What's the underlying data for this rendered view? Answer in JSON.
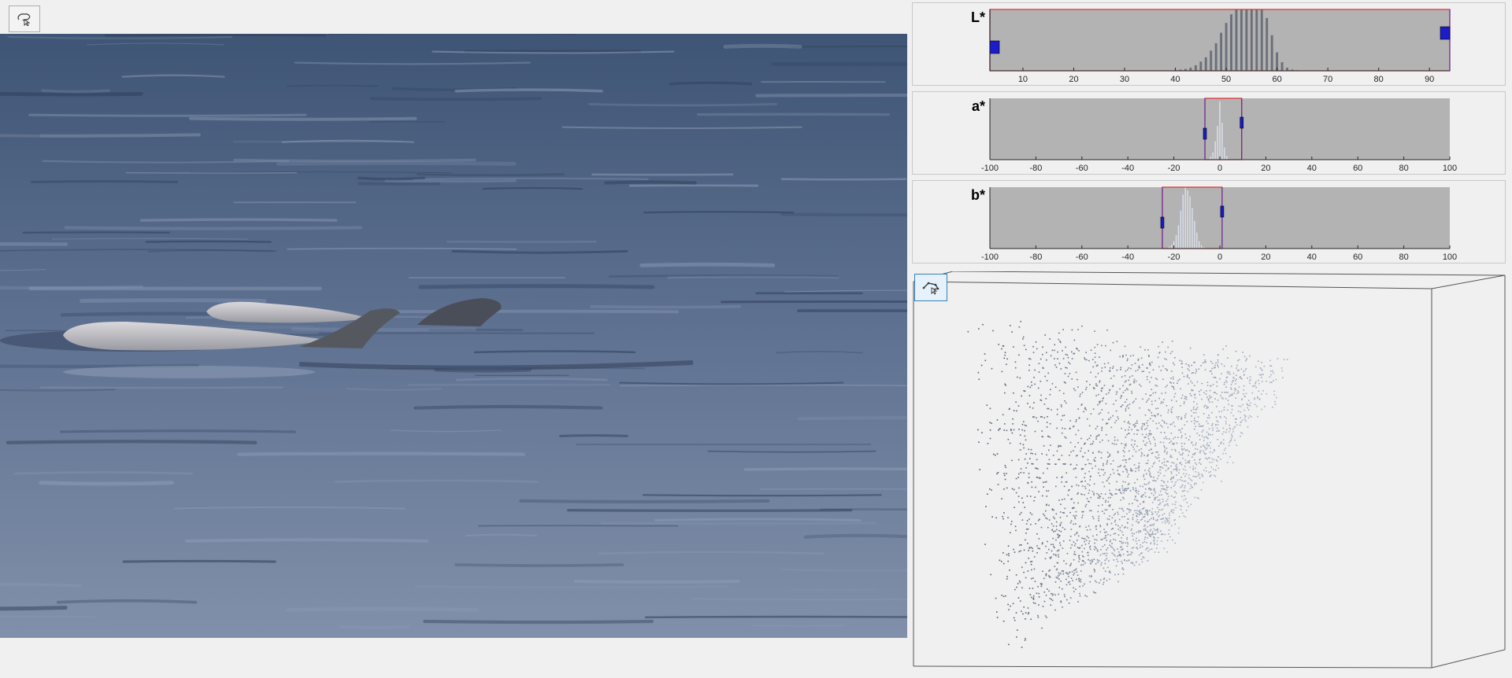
{
  "toolbar": {
    "freehand_tool": {
      "icon": "freehand-lasso-icon"
    },
    "polygon_tool": {
      "icon": "polygon-lasso-icon",
      "active": true
    }
  },
  "colors": {
    "histogram_background": "#b3b3b3",
    "range_box": "#e02828",
    "handle": "#1c1cc8",
    "polygon_tool_active": "#e5f1fb",
    "water_top": "#3f5575",
    "water_bottom": "#8190aa"
  },
  "histograms": [
    {
      "channel": "L*",
      "ticks": [
        "10",
        "20",
        "30",
        "40",
        "50",
        "60",
        "70",
        "80",
        "90"
      ],
      "axis_min": 3.5,
      "axis_max": 94,
      "selected_range": [
        3.5,
        94
      ],
      "bins": [
        [
          40,
          0.01
        ],
        [
          41,
          0.02
        ],
        [
          42,
          0.03
        ],
        [
          43,
          0.05
        ],
        [
          44,
          0.09
        ],
        [
          45,
          0.15
        ],
        [
          46,
          0.22
        ],
        [
          47,
          0.33
        ],
        [
          48,
          0.45
        ],
        [
          49,
          0.62
        ],
        [
          50,
          0.78
        ],
        [
          51,
          0.92
        ],
        [
          52,
          1.0
        ],
        [
          53,
          1.0
        ],
        [
          54,
          1.0
        ],
        [
          55,
          1.0
        ],
        [
          56,
          1.0
        ],
        [
          57,
          1.0
        ],
        [
          58,
          0.86
        ],
        [
          59,
          0.58
        ],
        [
          60,
          0.3
        ],
        [
          61,
          0.14
        ],
        [
          62,
          0.05
        ],
        [
          63,
          0.02
        ],
        [
          64,
          0.01
        ]
      ]
    },
    {
      "channel": "a*",
      "ticks": [
        "-100",
        "-80",
        "-60",
        "-40",
        "-20",
        "0",
        "20",
        "40",
        "60",
        "80",
        "100"
      ],
      "axis_min": -100,
      "axis_max": 100,
      "selected_range": [
        -6.5,
        9.5
      ],
      "bins": [
        [
          -4,
          0.05
        ],
        [
          -3,
          0.12
        ],
        [
          -2,
          0.3
        ],
        [
          -1,
          0.55
        ],
        [
          0,
          0.95
        ],
        [
          1,
          0.6
        ],
        [
          2,
          0.2
        ],
        [
          3,
          0.06
        ]
      ]
    },
    {
      "channel": "b*",
      "ticks": [
        "-100",
        "-80",
        "-60",
        "-40",
        "-20",
        "0",
        "20",
        "40",
        "60",
        "80",
        "100"
      ],
      "axis_min": -100,
      "axis_max": 100,
      "selected_range": [
        -25,
        1
      ],
      "bins": [
        [
          -22,
          0.03
        ],
        [
          -21,
          0.06
        ],
        [
          -20,
          0.12
        ],
        [
          -19,
          0.22
        ],
        [
          -18,
          0.38
        ],
        [
          -17,
          0.62
        ],
        [
          -16,
          0.88
        ],
        [
          -15,
          1.0
        ],
        [
          -14,
          0.95
        ],
        [
          -13,
          0.85
        ],
        [
          -12,
          0.66
        ],
        [
          -11,
          0.45
        ],
        [
          -10,
          0.26
        ],
        [
          -9,
          0.12
        ],
        [
          -8,
          0.05
        ],
        [
          -7,
          0.02
        ]
      ]
    }
  ]
}
